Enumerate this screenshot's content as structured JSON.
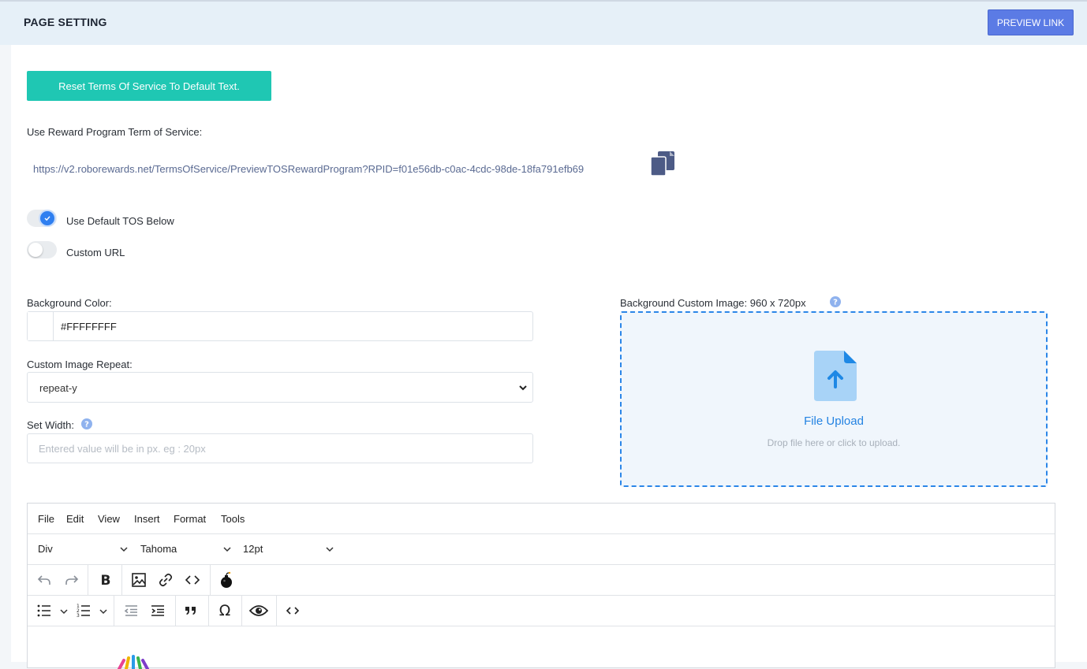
{
  "header": {
    "title": "PAGE SETTING",
    "preview_label": "PREVIEW LINK"
  },
  "reset_button_label": "Reset Terms Of Service To Default Text.",
  "tos": {
    "label": "Use Reward Program Term of Service:",
    "url": "https://v2.roborewards.net/TermsOfService/PreviewTOSRewardProgram?RPID=f01e56db-c0ac-4cdc-98de-18fa791efb69"
  },
  "toggles": {
    "default_tos": {
      "label": "Use Default TOS Below",
      "on": true
    },
    "custom_url": {
      "label": "Custom URL",
      "on": false
    }
  },
  "background_color": {
    "label": "Background Color:",
    "value": "#FFFFFFFF"
  },
  "image_repeat": {
    "label": "Custom Image Repeat:",
    "value": "repeat-y"
  },
  "set_width": {
    "label": "Set Width:",
    "placeholder": "Entered value will be in px. eg : 20px"
  },
  "custom_image": {
    "label": "Background Custom Image: 960 x 720px",
    "upload_title": "File Upload",
    "upload_hint": "Drop file here or click to upload."
  },
  "editor": {
    "menu": [
      "File",
      "Edit",
      "View",
      "Insert",
      "Format",
      "Tools"
    ],
    "block_format": "Div",
    "font_family": "Tahoma",
    "font_size": "12pt",
    "special_char_glyph": "Ω"
  },
  "colors": {
    "accent_teal": "#1fc7b3",
    "preview_blue": "#5b7be5",
    "upload_blue": "#2483e2",
    "header_bg": "#e6f0f8"
  },
  "icons": [
    "copy-icon",
    "help-icon",
    "file-upload-icon",
    "chevron-down-icon",
    "undo-icon",
    "redo-icon",
    "bold-icon",
    "image-icon",
    "link-icon",
    "code-icon",
    "bomb-icon",
    "bullet-list-icon",
    "numbered-list-icon",
    "outdent-icon",
    "indent-icon",
    "blockquote-icon",
    "omega-icon",
    "eye-icon",
    "source-code-icon"
  ]
}
